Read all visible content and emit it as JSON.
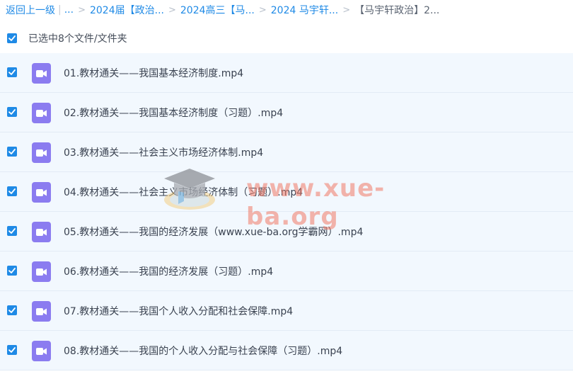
{
  "breadcrumb": {
    "back": "返回上一级",
    "bar": "|",
    "ellipsis": "...",
    "items": [
      "2024届【政治...",
      "2024高三【马...",
      "2024 马宇轩...",
      "【马宇轩政治】2..."
    ],
    "separator": ">"
  },
  "selection": {
    "text": "已选中8个文件/文件夹",
    "checked": true
  },
  "files": [
    {
      "name": "01.教材通关——我国基本经济制度.mp4",
      "checked": true,
      "icon": "video-icon"
    },
    {
      "name": "02.教材通关——我国基本经济制度（习题）.mp4",
      "checked": true,
      "icon": "video-icon"
    },
    {
      "name": "03.教材通关——社会主义市场经济体制.mp4",
      "checked": true,
      "icon": "video-icon"
    },
    {
      "name": "04.教材通关——社会主义市场经济体制（习题）.mp4",
      "checked": true,
      "icon": "video-icon"
    },
    {
      "name": "05.教材通关——我国的经济发展（www.xue-ba.org学霸网）.mp4",
      "checked": true,
      "icon": "video-icon"
    },
    {
      "name": "06.教材通关——我国的经济发展（习题）.mp4",
      "checked": true,
      "icon": "video-icon"
    },
    {
      "name": "07.教材通关——我国个人收入分配和社会保障.mp4",
      "checked": true,
      "icon": "video-icon"
    },
    {
      "name": "08.教材通关——我国的个人收入分配与社会保障（习题）.mp4",
      "checked": true,
      "icon": "video-icon"
    }
  ],
  "watermark": {
    "text": "www.xue-ba.org"
  },
  "colors": {
    "accent": "#1f8ae6",
    "row_bg": "#f2f8fe",
    "video_icon": "#8b7cf0"
  }
}
